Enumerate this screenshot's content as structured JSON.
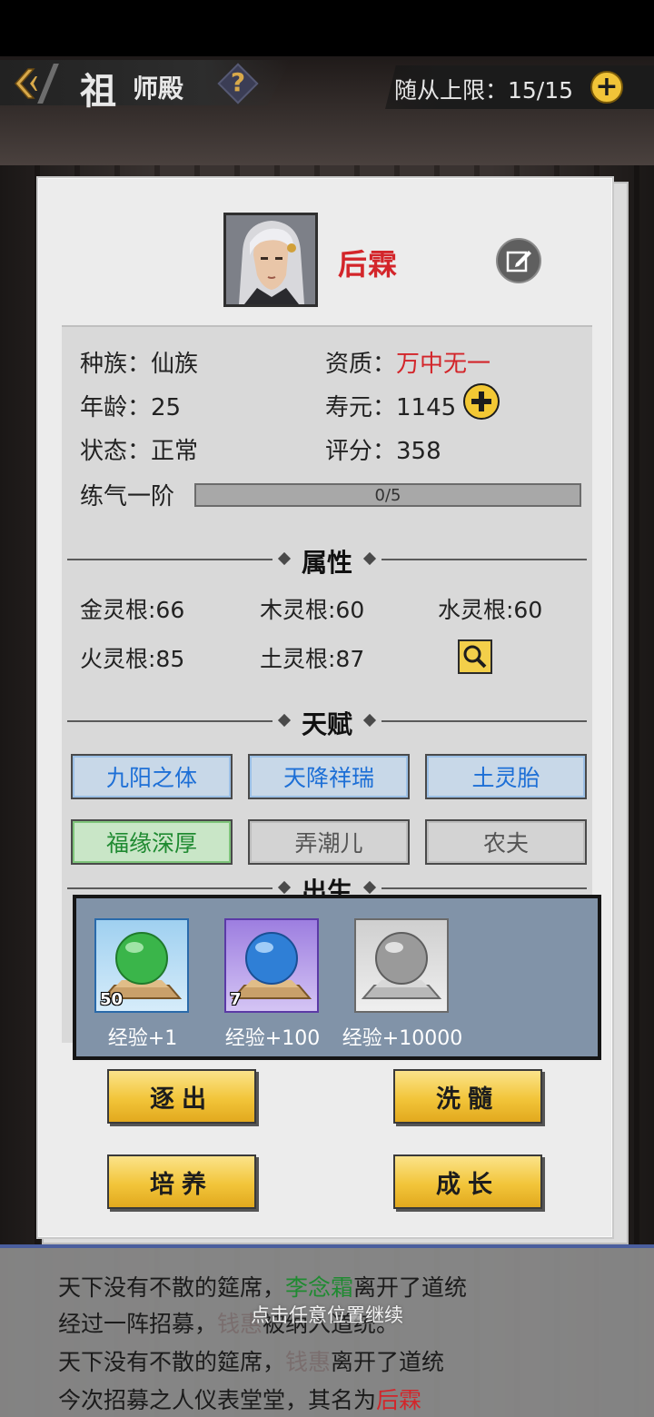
{
  "topbar": {
    "title_main": "祖",
    "title_sub": "师殿",
    "help_label": "?",
    "follower_limit": "随从上限：15/15",
    "follower_add": "+"
  },
  "character": {
    "name": "后霖"
  },
  "info": {
    "race": "种族：仙族",
    "quality_label": "资质：",
    "quality_value": "万中无一",
    "age": "年龄：25",
    "lifespan": "寿元：1145",
    "status": "状态：正常",
    "score": "评分：358",
    "realm": "练气一阶",
    "progress_text": "0/5",
    "progress_fraction": 0.0
  },
  "sections": {
    "attributes": "属性",
    "talents": "天赋",
    "origin": "出生"
  },
  "attributes": {
    "metal": "金灵根:66",
    "wood": "木灵根:60",
    "water": "水灵根:60",
    "fire": "火灵根:85",
    "earth": "土灵根:87"
  },
  "talents": [
    {
      "label": "九阳之体",
      "tier": "blue"
    },
    {
      "label": "天降祥瑞",
      "tier": "blue"
    },
    {
      "label": "土灵胎",
      "tier": "blue"
    },
    {
      "label": "福缘深厚",
      "tier": "green"
    },
    {
      "label": "弄潮儿",
      "tier": "gray"
    },
    {
      "label": "农夫",
      "tier": "gray"
    }
  ],
  "exp_items": [
    {
      "label": "经验+1",
      "count": "50",
      "color": "green"
    },
    {
      "label": "经验+100",
      "count": "7",
      "color": "blue"
    },
    {
      "label": "经验+10000",
      "count": "",
      "color": "gray"
    }
  ],
  "actions": {
    "expel": "逐出",
    "wash": "洗髓",
    "cultivate": "培养",
    "grow": "成长"
  },
  "log": {
    "line1_a": "天下没有不散的筵席，",
    "line1_name": "李念霜",
    "line1_b": "离开了道统",
    "line2_a": "经过一阵招募，",
    "line2_name": "钱惠",
    "line2_b": "被纳入道统。",
    "line3_a": "天下没有不散的筵席，",
    "line3_name": "钱惠",
    "line3_b": "离开了道统",
    "line4_a": "今次招募之人仪表堂堂，其名为",
    "line4_name": "后霖",
    "hint": "点击任意位置继续"
  },
  "colors": {
    "accent_red": "#d3252a",
    "talent_blue": "#1d6fd6",
    "talent_green": "#1f8a31",
    "button_gold": "#f2c53a"
  }
}
